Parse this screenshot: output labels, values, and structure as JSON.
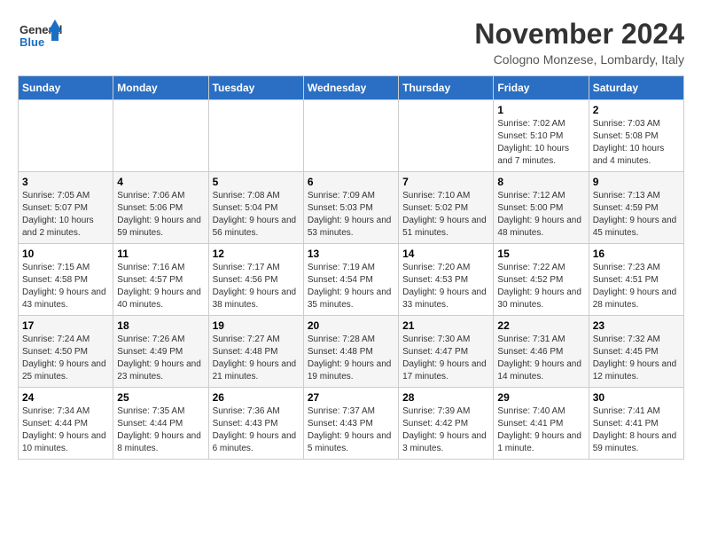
{
  "logo": {
    "general": "General",
    "blue": "Blue"
  },
  "title": "November 2024",
  "location": "Cologno Monzese, Lombardy, Italy",
  "headers": [
    "Sunday",
    "Monday",
    "Tuesday",
    "Wednesday",
    "Thursday",
    "Friday",
    "Saturday"
  ],
  "weeks": [
    [
      {
        "day": "",
        "info": ""
      },
      {
        "day": "",
        "info": ""
      },
      {
        "day": "",
        "info": ""
      },
      {
        "day": "",
        "info": ""
      },
      {
        "day": "",
        "info": ""
      },
      {
        "day": "1",
        "info": "Sunrise: 7:02 AM\nSunset: 5:10 PM\nDaylight: 10 hours and 7 minutes."
      },
      {
        "day": "2",
        "info": "Sunrise: 7:03 AM\nSunset: 5:08 PM\nDaylight: 10 hours and 4 minutes."
      }
    ],
    [
      {
        "day": "3",
        "info": "Sunrise: 7:05 AM\nSunset: 5:07 PM\nDaylight: 10 hours and 2 minutes."
      },
      {
        "day": "4",
        "info": "Sunrise: 7:06 AM\nSunset: 5:06 PM\nDaylight: 9 hours and 59 minutes."
      },
      {
        "day": "5",
        "info": "Sunrise: 7:08 AM\nSunset: 5:04 PM\nDaylight: 9 hours and 56 minutes."
      },
      {
        "day": "6",
        "info": "Sunrise: 7:09 AM\nSunset: 5:03 PM\nDaylight: 9 hours and 53 minutes."
      },
      {
        "day": "7",
        "info": "Sunrise: 7:10 AM\nSunset: 5:02 PM\nDaylight: 9 hours and 51 minutes."
      },
      {
        "day": "8",
        "info": "Sunrise: 7:12 AM\nSunset: 5:00 PM\nDaylight: 9 hours and 48 minutes."
      },
      {
        "day": "9",
        "info": "Sunrise: 7:13 AM\nSunset: 4:59 PM\nDaylight: 9 hours and 45 minutes."
      }
    ],
    [
      {
        "day": "10",
        "info": "Sunrise: 7:15 AM\nSunset: 4:58 PM\nDaylight: 9 hours and 43 minutes."
      },
      {
        "day": "11",
        "info": "Sunrise: 7:16 AM\nSunset: 4:57 PM\nDaylight: 9 hours and 40 minutes."
      },
      {
        "day": "12",
        "info": "Sunrise: 7:17 AM\nSunset: 4:56 PM\nDaylight: 9 hours and 38 minutes."
      },
      {
        "day": "13",
        "info": "Sunrise: 7:19 AM\nSunset: 4:54 PM\nDaylight: 9 hours and 35 minutes."
      },
      {
        "day": "14",
        "info": "Sunrise: 7:20 AM\nSunset: 4:53 PM\nDaylight: 9 hours and 33 minutes."
      },
      {
        "day": "15",
        "info": "Sunrise: 7:22 AM\nSunset: 4:52 PM\nDaylight: 9 hours and 30 minutes."
      },
      {
        "day": "16",
        "info": "Sunrise: 7:23 AM\nSunset: 4:51 PM\nDaylight: 9 hours and 28 minutes."
      }
    ],
    [
      {
        "day": "17",
        "info": "Sunrise: 7:24 AM\nSunset: 4:50 PM\nDaylight: 9 hours and 25 minutes."
      },
      {
        "day": "18",
        "info": "Sunrise: 7:26 AM\nSunset: 4:49 PM\nDaylight: 9 hours and 23 minutes."
      },
      {
        "day": "19",
        "info": "Sunrise: 7:27 AM\nSunset: 4:48 PM\nDaylight: 9 hours and 21 minutes."
      },
      {
        "day": "20",
        "info": "Sunrise: 7:28 AM\nSunset: 4:48 PM\nDaylight: 9 hours and 19 minutes."
      },
      {
        "day": "21",
        "info": "Sunrise: 7:30 AM\nSunset: 4:47 PM\nDaylight: 9 hours and 17 minutes."
      },
      {
        "day": "22",
        "info": "Sunrise: 7:31 AM\nSunset: 4:46 PM\nDaylight: 9 hours and 14 minutes."
      },
      {
        "day": "23",
        "info": "Sunrise: 7:32 AM\nSunset: 4:45 PM\nDaylight: 9 hours and 12 minutes."
      }
    ],
    [
      {
        "day": "24",
        "info": "Sunrise: 7:34 AM\nSunset: 4:44 PM\nDaylight: 9 hours and 10 minutes."
      },
      {
        "day": "25",
        "info": "Sunrise: 7:35 AM\nSunset: 4:44 PM\nDaylight: 9 hours and 8 minutes."
      },
      {
        "day": "26",
        "info": "Sunrise: 7:36 AM\nSunset: 4:43 PM\nDaylight: 9 hours and 6 minutes."
      },
      {
        "day": "27",
        "info": "Sunrise: 7:37 AM\nSunset: 4:43 PM\nDaylight: 9 hours and 5 minutes."
      },
      {
        "day": "28",
        "info": "Sunrise: 7:39 AM\nSunset: 4:42 PM\nDaylight: 9 hours and 3 minutes."
      },
      {
        "day": "29",
        "info": "Sunrise: 7:40 AM\nSunset: 4:41 PM\nDaylight: 9 hours and 1 minute."
      },
      {
        "day": "30",
        "info": "Sunrise: 7:41 AM\nSunset: 4:41 PM\nDaylight: 8 hours and 59 minutes."
      }
    ]
  ]
}
